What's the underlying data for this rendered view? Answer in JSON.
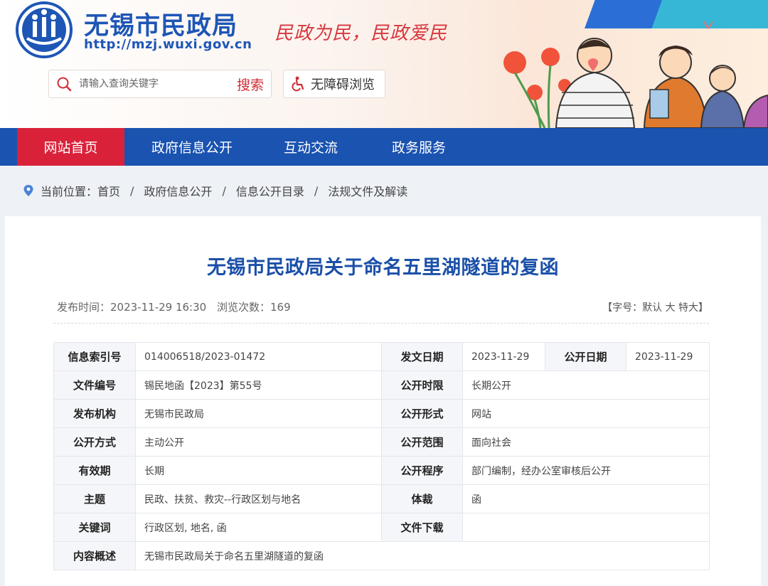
{
  "header": {
    "site_name": "无锡市民政局",
    "site_url": "http://mzj.wuxi.gov.cn",
    "slogan": "民政为民，民政爱民",
    "search_placeholder": "请输入查询关键字",
    "search_button": "搜索",
    "accessibility_button": "无障碍浏览"
  },
  "nav": {
    "items": [
      {
        "label": "网站首页",
        "active": true
      },
      {
        "label": "政府信息公开",
        "active": false
      },
      {
        "label": "互动交流",
        "active": false
      },
      {
        "label": "政务服务",
        "active": false
      }
    ]
  },
  "breadcrumb": {
    "prefix": "当前位置：",
    "items": [
      "首页",
      "政府信息公开",
      "信息公开目录",
      "法规文件及解读"
    ],
    "separator": "/"
  },
  "article": {
    "title": "无锡市民政局关于命名五里湖隧道的复函",
    "publish_label": "发布时间：",
    "publish_time": "2023-11-29 16:30",
    "views_label": "浏览次数：",
    "views": "169",
    "font_open": "【字号：",
    "font_default": "默认",
    "font_large": "大",
    "font_xlarge": "特大",
    "font_close": "】"
  },
  "info_table": {
    "index_label": "信息索引号",
    "index_value": "014006518/2023-01472",
    "issue_date_label": "发文日期",
    "issue_date_value": "2023-11-29",
    "open_date_label": "公开日期",
    "open_date_value": "2023-11-29",
    "doc_no_label": "文件编号",
    "doc_no_value": "锡民地函【2023】第55号",
    "open_period_label": "公开时限",
    "open_period_value": "长期公开",
    "publisher_label": "发布机构",
    "publisher_value": "无锡市民政局",
    "open_form_label": "公开形式",
    "open_form_value": "网站",
    "open_method_label": "公开方式",
    "open_method_value": "主动公开",
    "open_scope_label": "公开范围",
    "open_scope_value": "面向社会",
    "validity_label": "有效期",
    "validity_value": "长期",
    "procedure_label": "公开程序",
    "procedure_value": "部门编制，经办公室审核后公开",
    "topic_label": "主题",
    "topic_value": "民政、扶贫、救灾--行政区划与地名",
    "genre_label": "体裁",
    "genre_value": "函",
    "keywords_label": "关键词",
    "keywords_value": "行政区划, 地名, 函",
    "download_label": "文件下载",
    "download_value": "",
    "summary_label": "内容概述",
    "summary_value": "无锡市民政局关于命名五里湖隧道的复函"
  },
  "colors": {
    "brand_blue": "#1a53b0",
    "title_blue": "#1b4fa8",
    "accent_red": "#d9223a"
  }
}
